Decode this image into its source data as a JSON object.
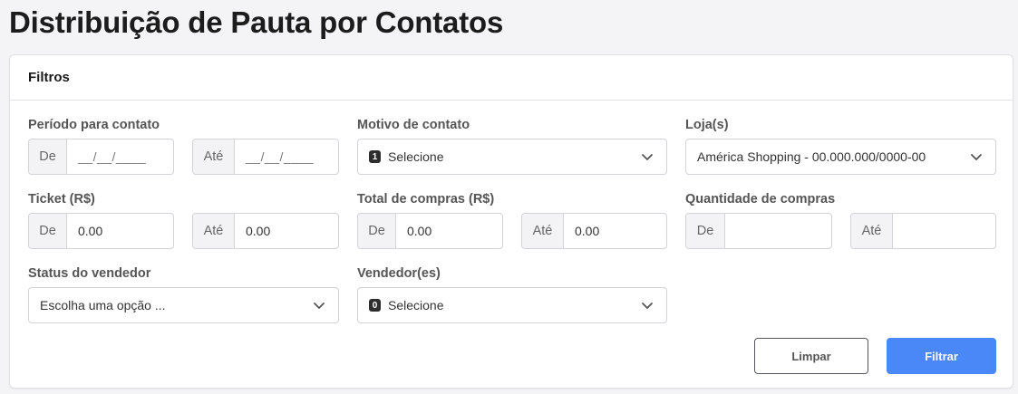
{
  "page": {
    "title": "Distribuição de Pauta por Contatos"
  },
  "filters": {
    "title": "Filtros",
    "periodo": {
      "label": "Período para contato",
      "from_addon": "De",
      "from_value": "__/__/____",
      "to_addon": "Até",
      "to_value": "__/__/____"
    },
    "motivo": {
      "label": "Motivo de contato",
      "badge": "1",
      "value": "Selecione"
    },
    "loja": {
      "label": "Loja(s)",
      "value": "América Shopping - 00.000.000/0000-00"
    },
    "ticket": {
      "label": "Ticket (R$)",
      "from_addon": "De",
      "from_value": "0.00",
      "to_addon": "Até",
      "to_value": "0.00"
    },
    "total_compras": {
      "label": "Total de compras (R$)",
      "from_addon": "De",
      "from_value": "0.00",
      "to_addon": "Até",
      "to_value": "0.00"
    },
    "quantidade": {
      "label": "Quantidade de compras",
      "from_addon": "De",
      "from_value": "",
      "to_addon": "Até",
      "to_value": ""
    },
    "status": {
      "label": "Status do vendedor",
      "value": "Escolha uma opção ..."
    },
    "vendedores": {
      "label": "Vendedor(es)",
      "badge": "0",
      "value": "Selecione"
    },
    "buttons": {
      "clear": "Limpar",
      "filter": "Filtrar"
    }
  },
  "colors": {
    "primary": "#4a87f7",
    "badge": "#2d2d2d"
  },
  "icons": {
    "select_arrow": "chevron-down-icon"
  }
}
